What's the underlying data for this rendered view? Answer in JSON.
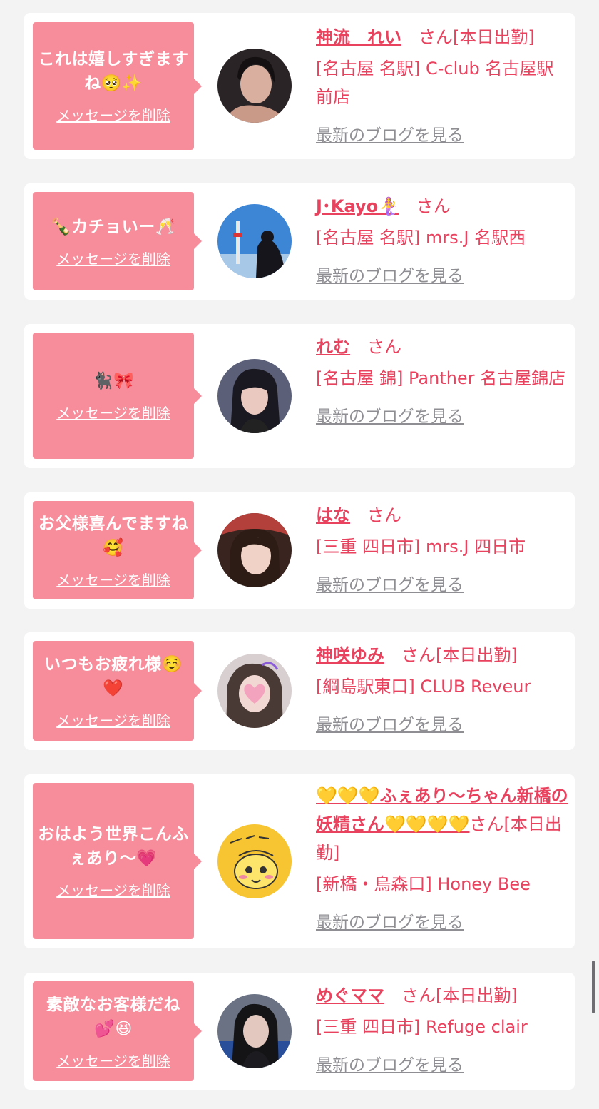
{
  "colors": {
    "background": "#f3f3f4",
    "card": "#ffffff",
    "bubble": "#f78d9b",
    "accent": "#e8425e",
    "link_gray": "#8e8e93"
  },
  "items": [
    {
      "message": "これは嬉しすぎますね🥺✨",
      "delete_label": "メッセージを削除",
      "name": "神流　れい",
      "honorific": "さん",
      "status": "[本日出勤]",
      "shop": "[名古屋 名駅] C-club 名古屋駅前店",
      "blog_label": "最新のブログを見る",
      "avatar_icon": "avatar-photo-woman"
    },
    {
      "message": "🍾カチョいー🥂",
      "delete_label": "メッセージを削除",
      "name": "J･Kayo🧜‍♀️",
      "honorific": "さん",
      "status": "",
      "shop": "[名古屋 名駅] mrs.J 名駅西",
      "blog_label": "最新のブログを見る",
      "avatar_icon": "avatar-photo-tower"
    },
    {
      "message": "🐈‍⬛🎀",
      "delete_label": "メッセージを削除",
      "name": "れむ",
      "honorific": "さん",
      "status": "",
      "shop": "[名古屋 錦] Panther 名古屋錦店",
      "blog_label": "最新のブログを見る",
      "avatar_icon": "avatar-photo-woman"
    },
    {
      "message": "お父様喜んでますね🥰",
      "delete_label": "メッセージを削除",
      "name": "はな",
      "honorific": "さん",
      "status": "",
      "shop": "[三重 四日市] mrs.J 四日市",
      "blog_label": "最新のブログを見る",
      "avatar_icon": "avatar-photo-woman"
    },
    {
      "message": "いつもお疲れ様☺️❤️",
      "delete_label": "メッセージを削除",
      "name": "神咲ゆみ",
      "honorific": "さん",
      "status": "[本日出勤]",
      "shop": "[綱島駅東口] CLUB Reveur",
      "blog_label": "最新のブログを見る",
      "avatar_icon": "avatar-photo-woman"
    },
    {
      "message": "おはよう世界こんふぇあり〜💗",
      "delete_label": "メッセージを削除",
      "name": "💛💛💛ふぇあり〜ちゃん新橋の妖精さん💛💛💛💛",
      "honorific": "さん",
      "status": "[本日出勤]",
      "shop": "[新橋・烏森口] Honey Bee",
      "blog_label": "最新のブログを見る",
      "avatar_icon": "avatar-illustration-fairy"
    },
    {
      "message": "素敵なお客様だね💕😆",
      "delete_label": "メッセージを削除",
      "name": "めぐママ",
      "honorific": "さん",
      "status": "[本日出勤]",
      "shop": "[三重 四日市] Refuge clair",
      "blog_label": "最新のブログを見る",
      "avatar_icon": "avatar-photo-woman"
    }
  ]
}
